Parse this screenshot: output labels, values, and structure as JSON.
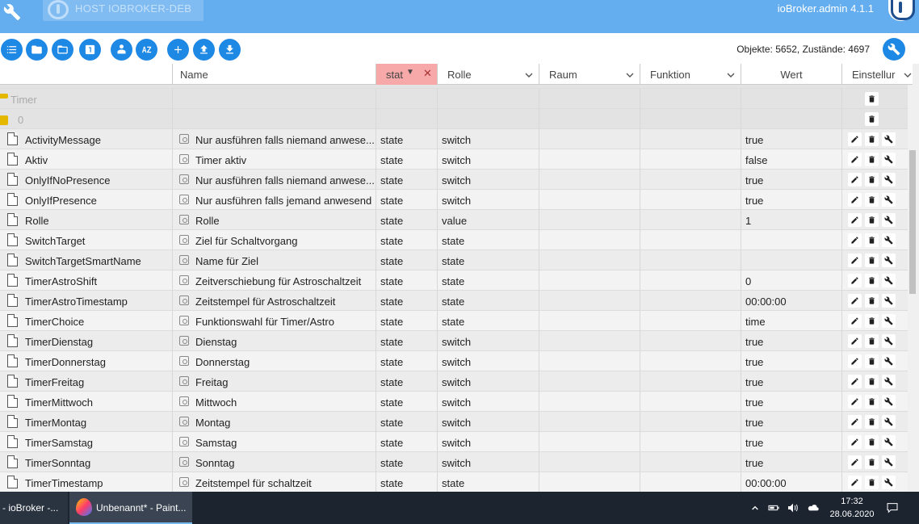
{
  "appbar": {
    "host_label": "HOST IOBROKER-DEB",
    "version": "ioBroker.admin 4.1.1"
  },
  "toolbar": {
    "object_count": "Objekte: 5652, Zustände: 4697"
  },
  "columns": {
    "name": "Name",
    "type": "stat",
    "role": "Rolle",
    "room": "Raum",
    "function": "Funktion",
    "value": "Wert",
    "settings": "Einstellur"
  },
  "folders": [
    {
      "label": "Timer"
    },
    {
      "label": "0"
    }
  ],
  "rows": [
    {
      "id": "ActivityMessage",
      "name": "Nur ausführen falls niemand anwese...",
      "type": "state",
      "role": "switch",
      "value": "true"
    },
    {
      "id": "Aktiv",
      "name": "Timer aktiv",
      "type": "state",
      "role": "switch",
      "value": "false"
    },
    {
      "id": "OnlyIfNoPresence",
      "name": "Nur ausführen falls niemand anwese...",
      "type": "state",
      "role": "switch",
      "value": "true"
    },
    {
      "id": "OnlyIfPresence",
      "name": "Nur ausführen falls jemand anwesend",
      "type": "state",
      "role": "switch",
      "value": "true"
    },
    {
      "id": "Rolle",
      "name": "Rolle",
      "type": "state",
      "role": "value",
      "value": "1"
    },
    {
      "id": "SwitchTarget",
      "name": "Ziel für Schaltvorgang",
      "type": "state",
      "role": "state",
      "value": ""
    },
    {
      "id": "SwitchTargetSmartName",
      "name": "Name für Ziel",
      "type": "state",
      "role": "state",
      "value": ""
    },
    {
      "id": "TimerAstroShift",
      "name": "Zeitverschiebung für Astroschaltzeit",
      "type": "state",
      "role": "state",
      "value": "0"
    },
    {
      "id": "TimerAstroTimestamp",
      "name": "Zeitstempel für Astroschaltzeit",
      "type": "state",
      "role": "state",
      "value": "00:00:00"
    },
    {
      "id": "TimerChoice",
      "name": "Funktionswahl für Timer/Astro",
      "type": "state",
      "role": "state",
      "value": "time"
    },
    {
      "id": "TimerDienstag",
      "name": "Dienstag",
      "type": "state",
      "role": "switch",
      "value": "true"
    },
    {
      "id": "TimerDonnerstag",
      "name": "Donnerstag",
      "type": "state",
      "role": "switch",
      "value": "true"
    },
    {
      "id": "TimerFreitag",
      "name": "Freitag",
      "type": "state",
      "role": "switch",
      "value": "true"
    },
    {
      "id": "TimerMittwoch",
      "name": "Mittwoch",
      "type": "state",
      "role": "switch",
      "value": "true"
    },
    {
      "id": "TimerMontag",
      "name": "Montag",
      "type": "state",
      "role": "switch",
      "value": "true"
    },
    {
      "id": "TimerSamstag",
      "name": "Samstag",
      "type": "state",
      "role": "switch",
      "value": "true"
    },
    {
      "id": "TimerSonntag",
      "name": "Sonntag",
      "type": "state",
      "role": "switch",
      "value": "true"
    },
    {
      "id": "TimerTimestamp",
      "name": "Zeitstempel für schaltzeit",
      "type": "state",
      "role": "state",
      "value": "00:00:00"
    }
  ],
  "taskbar": {
    "task1": "- ioBroker -...",
    "task2": "Unbenannt* - Paint...",
    "time": "17:32",
    "date": "28.06.2020"
  },
  "colors": {
    "appbar": "#64aef0",
    "button": "#1e88e5",
    "filter_header": "#f7a8a8",
    "taskbar": "#1c2430"
  }
}
